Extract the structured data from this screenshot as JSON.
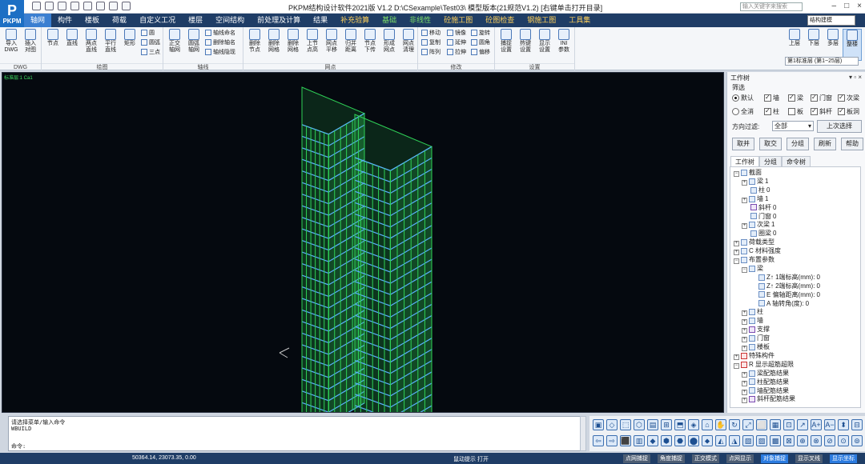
{
  "app": {
    "logo_text": "PKPM",
    "title": "PKPM结构设计软件2021版 V1.2 D:\\CSexample\\Test03\\  模型版本(21规范V1.2)  [右键单击打开目录]",
    "search_placeholder": "输入关键字来搜索",
    "window_buttons": [
      "–",
      "□",
      "×"
    ]
  },
  "menu": {
    "tabs": [
      {
        "label": "轴网",
        "active": true,
        "style": "active"
      },
      {
        "label": "构件",
        "style": ""
      },
      {
        "label": "楼板",
        "style": ""
      },
      {
        "label": "荷载",
        "style": ""
      },
      {
        "label": "自定义工况",
        "style": ""
      },
      {
        "label": "楼层",
        "style": ""
      },
      {
        "label": "空间结构",
        "style": ""
      },
      {
        "label": "前处理及计算",
        "style": ""
      },
      {
        "label": "结果",
        "style": ""
      },
      {
        "label": "补充验算",
        "style": "hl"
      },
      {
        "label": "基础",
        "style": "green"
      },
      {
        "label": "非线性",
        "style": "green"
      },
      {
        "label": "砼施工图",
        "style": "hl"
      },
      {
        "label": "砼图检查",
        "style": "hl"
      },
      {
        "label": "钢施工图",
        "style": "hl"
      },
      {
        "label": "工具集",
        "style": "hl"
      }
    ],
    "mode_select": "结构建模"
  },
  "ribbon": {
    "groups": [
      {
        "label": "DWG",
        "buttons": [
          "导入\nDWG",
          "插入\n对图"
        ]
      },
      {
        "label": "绘图",
        "buttons": [
          "节点",
          "直线",
          "两点\n直线",
          "平行\n直线",
          "矩形"
        ],
        "small": [
          "圆",
          "圆弧",
          "三点"
        ]
      },
      {
        "label": "轴线",
        "buttons": [
          "正交\n轴网",
          "圆弧\n轴网",
          "轴线\n命名"
        ],
        "small": [
          "轴线命名",
          "删除轴名",
          "轴线隐现"
        ]
      },
      {
        "label": "网点",
        "buttons": [
          "删除\n节点",
          "删除\n网格",
          "删除\n网格",
          "上节\n点高",
          "网点\n平移",
          "归并\n距离",
          "节点\n下传",
          "形成\n网点",
          "网点\n清理"
        ]
      },
      {
        "label": "修改",
        "small": [
          "移动",
          "镜像",
          "旋转",
          "复制",
          "延伸",
          "圆角",
          "阵列",
          "拉伸",
          "偏移"
        ]
      },
      {
        "label": "设置",
        "buttons": [
          "捕捉\n设置",
          "热键\n设置",
          "显示\n设置",
          "INI\n参数"
        ]
      }
    ],
    "floor_buttons": [
      "上层",
      "下层",
      "多层",
      "整楼"
    ],
    "floor_select": "第1标准层 (第1~25层)"
  },
  "canvas": {
    "tag": "标准层:1 Ca1"
  },
  "panel": {
    "title": "工作树",
    "controls": "▾ ▫ ×",
    "filter_label": "筛选",
    "radio_default": "默认",
    "radio_all": "全消",
    "checks_row1": [
      {
        "label": "墙",
        "checked": true
      },
      {
        "label": "梁",
        "checked": true
      },
      {
        "label": "门窗",
        "checked": true
      },
      {
        "label": "次梁",
        "checked": true
      }
    ],
    "checks_row2": [
      {
        "label": "柱",
        "checked": true
      },
      {
        "label": "板",
        "checked": false
      },
      {
        "label": "斜杆",
        "checked": true
      },
      {
        "label": "板洞",
        "checked": true
      }
    ],
    "direction_label": "方向过滤:",
    "direction_value": "全部",
    "prev_select": "上次选择",
    "buttons": [
      "取并",
      "取交",
      "分组",
      "刷新",
      "帮助"
    ],
    "tabs": [
      "工作树",
      "分组",
      "命令树"
    ],
    "tree": [
      {
        "depth": 0,
        "exp": "−",
        "icon": "blue",
        "label": "截面",
        "val": ""
      },
      {
        "depth": 1,
        "exp": "+",
        "icon": "blue",
        "label": "梁",
        "val": "1"
      },
      {
        "depth": 1,
        "exp": "",
        "icon": "blue",
        "label": "柱",
        "val": "0"
      },
      {
        "depth": 1,
        "exp": "+",
        "icon": "blue",
        "label": "墙",
        "val": "1"
      },
      {
        "depth": 1,
        "exp": "",
        "icon": "purple",
        "label": "斜杆",
        "val": "0"
      },
      {
        "depth": 1,
        "exp": "",
        "icon": "blue",
        "label": "门窗",
        "val": "0"
      },
      {
        "depth": 1,
        "exp": "+",
        "icon": "blue",
        "label": "次梁",
        "val": "1"
      },
      {
        "depth": 1,
        "exp": "",
        "icon": "blue",
        "label": "圈梁",
        "val": "0"
      },
      {
        "depth": 0,
        "exp": "+",
        "icon": "blue",
        "label": "荷载类型",
        "val": ""
      },
      {
        "depth": 0,
        "exp": "+",
        "icon": "blue",
        "label": "C  材料强度",
        "val": ""
      },
      {
        "depth": 0,
        "exp": "−",
        "icon": "blue",
        "label": "布置参数",
        "val": ""
      },
      {
        "depth": 1,
        "exp": "−",
        "icon": "blue",
        "label": "梁",
        "val": ""
      },
      {
        "depth": 2,
        "exp": "",
        "icon": "blue",
        "label": "Z↑ 1端标高(mm):",
        "val": "0"
      },
      {
        "depth": 2,
        "exp": "",
        "icon": "blue",
        "label": "Z↑ 2端标高(mm):",
        "val": "0"
      },
      {
        "depth": 2,
        "exp": "",
        "icon": "blue",
        "label": "E  偏轴距离(mm):",
        "val": "0"
      },
      {
        "depth": 2,
        "exp": "",
        "icon": "blue",
        "label": "A  轴转角(度):",
        "val": "0"
      },
      {
        "depth": 1,
        "exp": "+",
        "icon": "blue",
        "label": "柱",
        "val": ""
      },
      {
        "depth": 1,
        "exp": "+",
        "icon": "blue",
        "label": "墙",
        "val": ""
      },
      {
        "depth": 1,
        "exp": "+",
        "icon": "purple",
        "label": "支撑",
        "val": ""
      },
      {
        "depth": 1,
        "exp": "+",
        "icon": "blue",
        "label": "门窗",
        "val": ""
      },
      {
        "depth": 1,
        "exp": "+",
        "icon": "blue",
        "label": "楼板",
        "val": ""
      },
      {
        "depth": 0,
        "exp": "+",
        "icon": "red",
        "label": "特殊构件",
        "val": ""
      },
      {
        "depth": 0,
        "exp": "−",
        "icon": "red",
        "label": "R  显示超筋超限",
        "val": ""
      },
      {
        "depth": 1,
        "exp": "+",
        "icon": "blue",
        "label": "梁配筋结果",
        "val": ""
      },
      {
        "depth": 1,
        "exp": "+",
        "icon": "blue",
        "label": "柱配筋结果",
        "val": ""
      },
      {
        "depth": 1,
        "exp": "+",
        "icon": "blue",
        "label": "墙配筋结果",
        "val": ""
      },
      {
        "depth": 1,
        "exp": "+",
        "icon": "purple",
        "label": "斜杆配筋结果",
        "val": ""
      }
    ]
  },
  "command": {
    "line1": "请选择菜单/输入命令",
    "line2": "WBUILD",
    "prompt": "命令:"
  },
  "status": {
    "coords": "50364.14, 23073.35, 0.00",
    "message": "鼠动提示  打开",
    "buttons": [
      {
        "label": "点网捕捉",
        "on": false
      },
      {
        "label": "角度捕捉",
        "on": false
      },
      {
        "label": "正交模式",
        "on": false
      },
      {
        "label": "点网显示",
        "on": false
      },
      {
        "label": "对象捕捉",
        "on": true
      },
      {
        "label": "显示叉线",
        "on": false
      },
      {
        "label": "显示坐标",
        "on": true
      }
    ]
  },
  "view_tools": [
    "▣",
    "◇",
    "⬚",
    "⬡",
    "▤",
    "⊞",
    "⬒",
    "◈",
    "⌂",
    "✋",
    "↻",
    "⤢",
    "⬜",
    "▦",
    "⊡",
    "↗",
    "A+",
    "A−",
    "⬍",
    "⊟",
    "⇦",
    "⇨",
    "⬛",
    "▥",
    "◆",
    "⬢",
    "⬣",
    "⬤",
    "⬥",
    "◭",
    "◮",
    "▧",
    "▨",
    "▩",
    "⊠",
    "⊕",
    "⊗",
    "⊘",
    "⊙",
    "⊚"
  ],
  "colors": {
    "menubar": "#1f3d66",
    "active_tab": "#3b7fd1",
    "canvas_bg": "#05090f",
    "wall_green": "#2fd157",
    "beam_blue": "#5ab0ff"
  }
}
